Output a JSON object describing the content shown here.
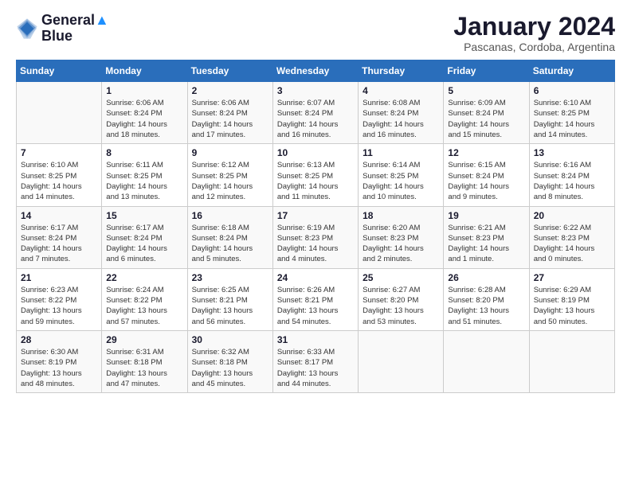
{
  "logo": {
    "line1": "General",
    "line2": "Blue"
  },
  "title": "January 2024",
  "subtitle": "Pascanas, Cordoba, Argentina",
  "weekdays": [
    "Sunday",
    "Monday",
    "Tuesday",
    "Wednesday",
    "Thursday",
    "Friday",
    "Saturday"
  ],
  "weeks": [
    [
      {
        "day": "",
        "info": ""
      },
      {
        "day": "1",
        "info": "Sunrise: 6:06 AM\nSunset: 8:24 PM\nDaylight: 14 hours\nand 18 minutes."
      },
      {
        "day": "2",
        "info": "Sunrise: 6:06 AM\nSunset: 8:24 PM\nDaylight: 14 hours\nand 17 minutes."
      },
      {
        "day": "3",
        "info": "Sunrise: 6:07 AM\nSunset: 8:24 PM\nDaylight: 14 hours\nand 16 minutes."
      },
      {
        "day": "4",
        "info": "Sunrise: 6:08 AM\nSunset: 8:24 PM\nDaylight: 14 hours\nand 16 minutes."
      },
      {
        "day": "5",
        "info": "Sunrise: 6:09 AM\nSunset: 8:24 PM\nDaylight: 14 hours\nand 15 minutes."
      },
      {
        "day": "6",
        "info": "Sunrise: 6:10 AM\nSunset: 8:25 PM\nDaylight: 14 hours\nand 14 minutes."
      }
    ],
    [
      {
        "day": "7",
        "info": "Sunrise: 6:10 AM\nSunset: 8:25 PM\nDaylight: 14 hours\nand 14 minutes."
      },
      {
        "day": "8",
        "info": "Sunrise: 6:11 AM\nSunset: 8:25 PM\nDaylight: 14 hours\nand 13 minutes."
      },
      {
        "day": "9",
        "info": "Sunrise: 6:12 AM\nSunset: 8:25 PM\nDaylight: 14 hours\nand 12 minutes."
      },
      {
        "day": "10",
        "info": "Sunrise: 6:13 AM\nSunset: 8:25 PM\nDaylight: 14 hours\nand 11 minutes."
      },
      {
        "day": "11",
        "info": "Sunrise: 6:14 AM\nSunset: 8:25 PM\nDaylight: 14 hours\nand 10 minutes."
      },
      {
        "day": "12",
        "info": "Sunrise: 6:15 AM\nSunset: 8:24 PM\nDaylight: 14 hours\nand 9 minutes."
      },
      {
        "day": "13",
        "info": "Sunrise: 6:16 AM\nSunset: 8:24 PM\nDaylight: 14 hours\nand 8 minutes."
      }
    ],
    [
      {
        "day": "14",
        "info": "Sunrise: 6:17 AM\nSunset: 8:24 PM\nDaylight: 14 hours\nand 7 minutes."
      },
      {
        "day": "15",
        "info": "Sunrise: 6:17 AM\nSunset: 8:24 PM\nDaylight: 14 hours\nand 6 minutes."
      },
      {
        "day": "16",
        "info": "Sunrise: 6:18 AM\nSunset: 8:24 PM\nDaylight: 14 hours\nand 5 minutes."
      },
      {
        "day": "17",
        "info": "Sunrise: 6:19 AM\nSunset: 8:23 PM\nDaylight: 14 hours\nand 4 minutes."
      },
      {
        "day": "18",
        "info": "Sunrise: 6:20 AM\nSunset: 8:23 PM\nDaylight: 14 hours\nand 2 minutes."
      },
      {
        "day": "19",
        "info": "Sunrise: 6:21 AM\nSunset: 8:23 PM\nDaylight: 14 hours\nand 1 minute."
      },
      {
        "day": "20",
        "info": "Sunrise: 6:22 AM\nSunset: 8:23 PM\nDaylight: 14 hours\nand 0 minutes."
      }
    ],
    [
      {
        "day": "21",
        "info": "Sunrise: 6:23 AM\nSunset: 8:22 PM\nDaylight: 13 hours\nand 59 minutes."
      },
      {
        "day": "22",
        "info": "Sunrise: 6:24 AM\nSunset: 8:22 PM\nDaylight: 13 hours\nand 57 minutes."
      },
      {
        "day": "23",
        "info": "Sunrise: 6:25 AM\nSunset: 8:21 PM\nDaylight: 13 hours\nand 56 minutes."
      },
      {
        "day": "24",
        "info": "Sunrise: 6:26 AM\nSunset: 8:21 PM\nDaylight: 13 hours\nand 54 minutes."
      },
      {
        "day": "25",
        "info": "Sunrise: 6:27 AM\nSunset: 8:20 PM\nDaylight: 13 hours\nand 53 minutes."
      },
      {
        "day": "26",
        "info": "Sunrise: 6:28 AM\nSunset: 8:20 PM\nDaylight: 13 hours\nand 51 minutes."
      },
      {
        "day": "27",
        "info": "Sunrise: 6:29 AM\nSunset: 8:19 PM\nDaylight: 13 hours\nand 50 minutes."
      }
    ],
    [
      {
        "day": "28",
        "info": "Sunrise: 6:30 AM\nSunset: 8:19 PM\nDaylight: 13 hours\nand 48 minutes."
      },
      {
        "day": "29",
        "info": "Sunrise: 6:31 AM\nSunset: 8:18 PM\nDaylight: 13 hours\nand 47 minutes."
      },
      {
        "day": "30",
        "info": "Sunrise: 6:32 AM\nSunset: 8:18 PM\nDaylight: 13 hours\nand 45 minutes."
      },
      {
        "day": "31",
        "info": "Sunrise: 6:33 AM\nSunset: 8:17 PM\nDaylight: 13 hours\nand 44 minutes."
      },
      {
        "day": "",
        "info": ""
      },
      {
        "day": "",
        "info": ""
      },
      {
        "day": "",
        "info": ""
      }
    ]
  ]
}
